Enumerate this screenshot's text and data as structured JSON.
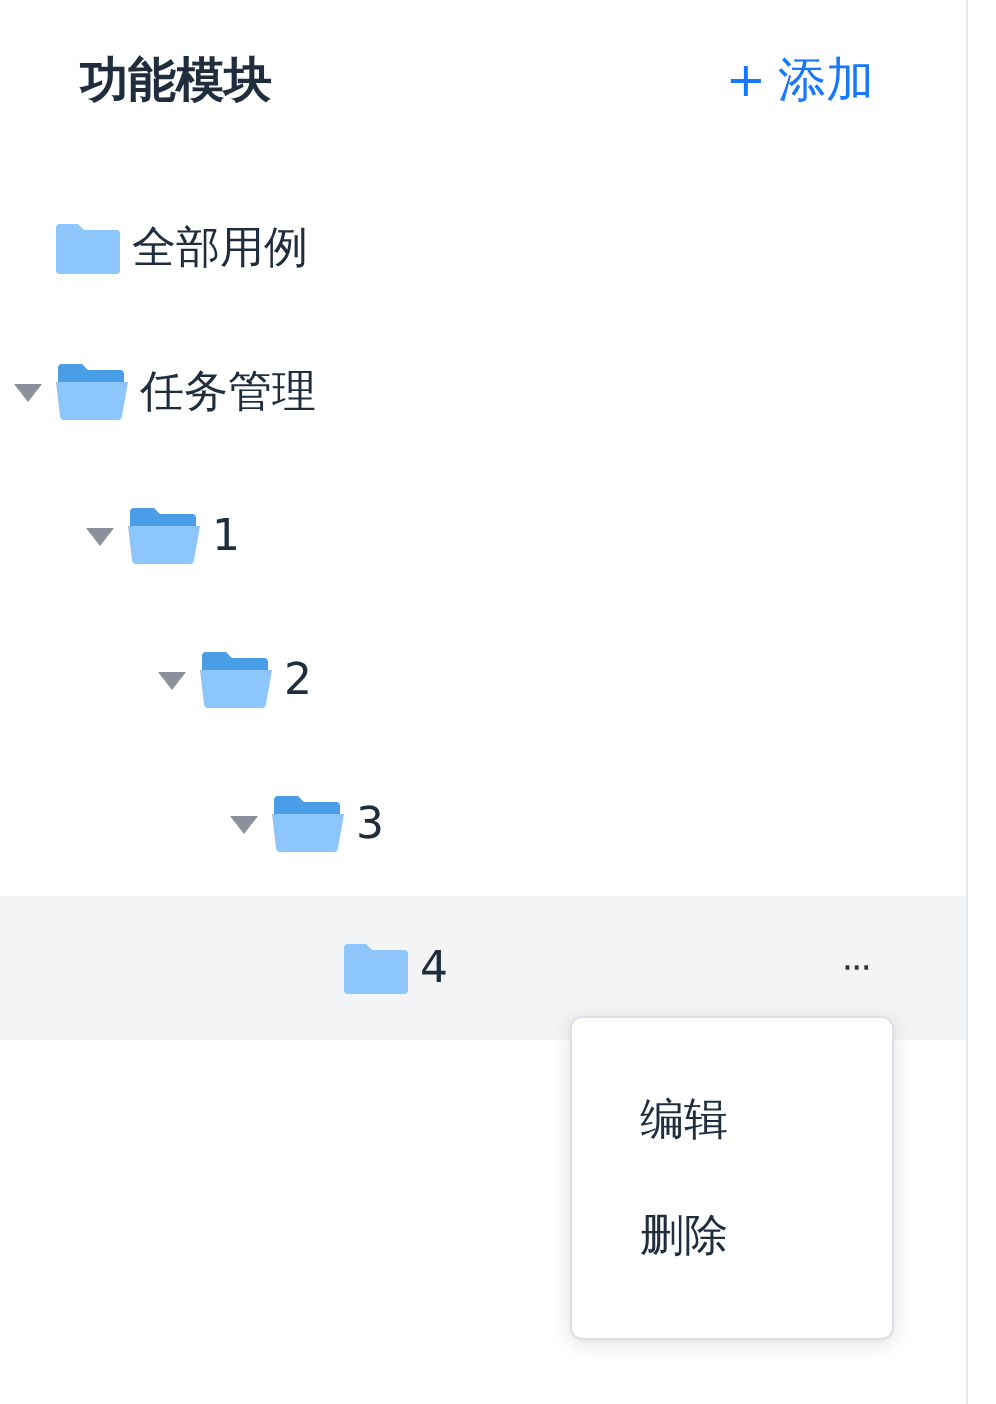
{
  "header": {
    "title": "功能模块",
    "add_button": {
      "icon": "+",
      "label": "添加"
    }
  },
  "tree": [
    {
      "label": "全部用例",
      "selected": false
    },
    {
      "label": "任务管理",
      "expanded": true,
      "selected": false,
      "children": [
        {
          "label": "1",
          "expanded": true,
          "selected": false,
          "children": [
            {
              "label": "2",
              "expanded": true,
              "selected": false,
              "children": [
                {
                  "label": "3",
                  "expanded": true,
                  "selected": false,
                  "children": [
                    {
                      "label": "4",
                      "selected": true,
                      "more": "···"
                    }
                  ]
                }
              ]
            }
          ]
        }
      ]
    }
  ],
  "context_menu": {
    "items": [
      "编辑",
      "删除"
    ]
  }
}
